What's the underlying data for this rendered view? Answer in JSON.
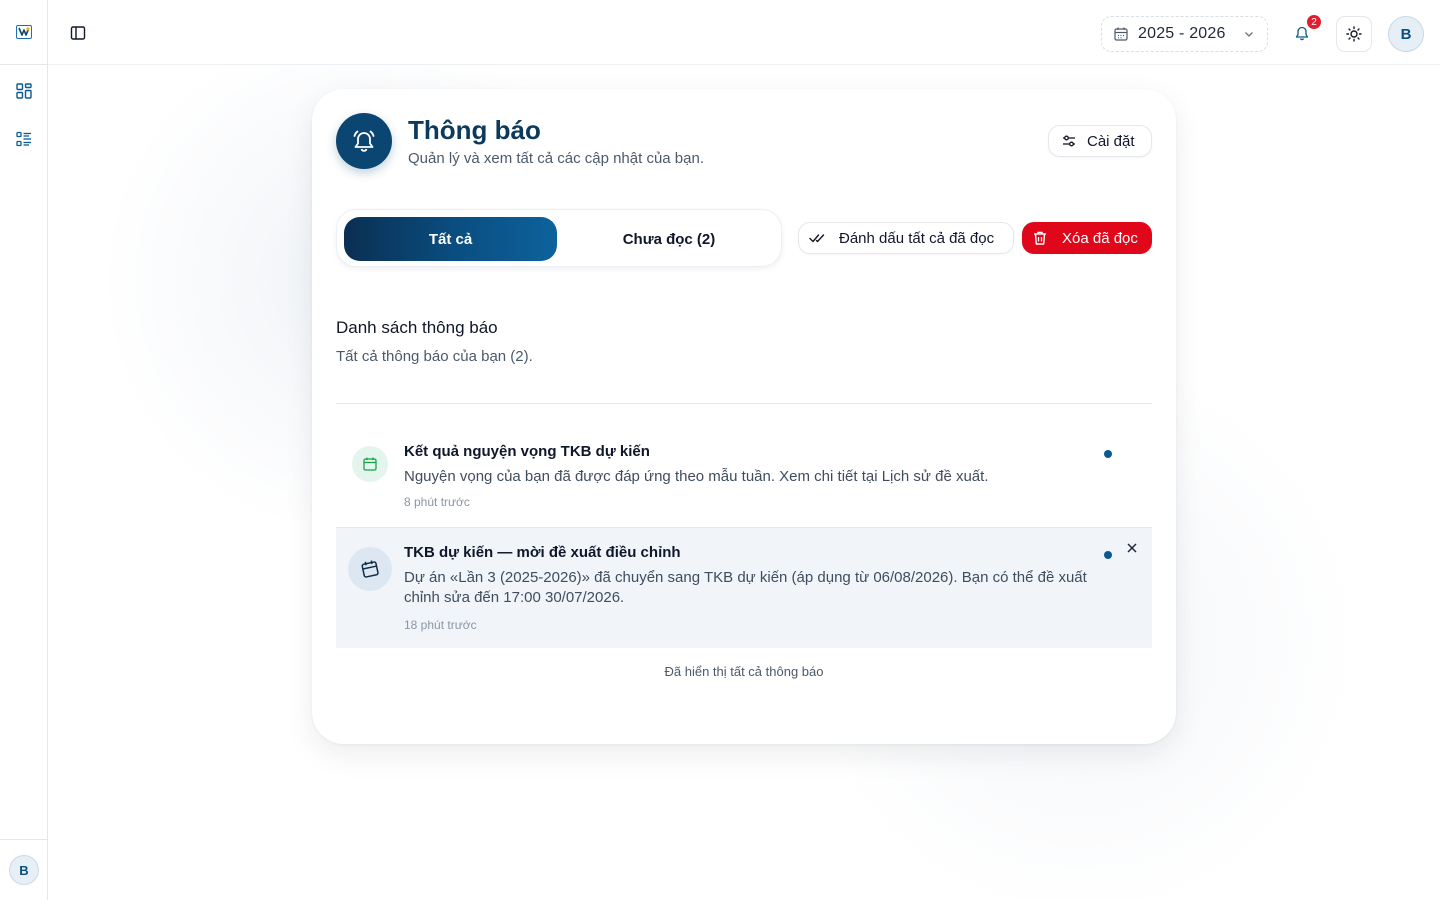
{
  "header": {
    "year": "2025 - 2026",
    "notification_count": "2",
    "avatar_initial": "B"
  },
  "sidebar": {
    "avatar_initial": "B",
    "items": [
      {
        "icon": "dashboard-grid-icon"
      },
      {
        "icon": "list-checks-icon"
      }
    ]
  },
  "page": {
    "title": "Thông báo",
    "subtitle": "Quản lý và xem tất cả các cập nhật của bạn.",
    "settings_label": "Cài đặt"
  },
  "tabs": {
    "all": "Tất cả",
    "unread": "Chưa đọc (2)"
  },
  "actions": {
    "mark_all_read": "Đánh dấu tất cả đã đọc",
    "delete_read": "Xóa đã đọc"
  },
  "list": {
    "title": "Danh sách thông báo",
    "subtitle": "Tất cả thông báo của bạn (2).",
    "items": [
      {
        "title": "Kết quả nguyện vọng TKB dự kiến",
        "body": "Nguyện vọng của bạn đã được đáp ứng theo mẫu tuần. Xem chi tiết tại Lịch sử đề xuất.",
        "time": "8 phút trước"
      },
      {
        "title": "TKB dự kiến — mời đề xuất điều chỉnh",
        "body": "Dự án «Lần 3 (2025-2026)» đã chuyển sang TKB dự kiến (áp dụng từ 06/08/2026). Bạn có thể đề xuất chỉnh sửa đến 17:00 30/07/2026.",
        "time": "18 phút trước"
      }
    ],
    "footer": "Đã hiển thị tất cả thông báo"
  },
  "colors": {
    "primary": "#0a4671",
    "danger": "#e0071b",
    "unread_dot": "#0b5a8f"
  }
}
